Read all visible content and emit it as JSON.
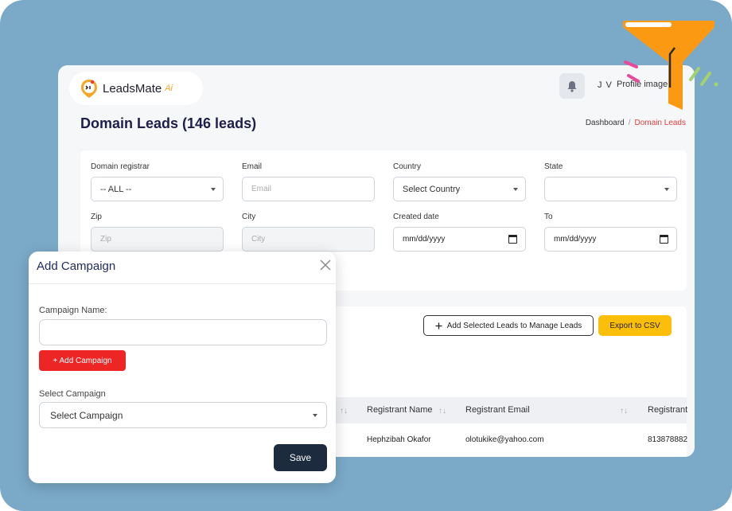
{
  "app": {
    "logo_name": "LeadsMate",
    "logo_suffix": "Ai",
    "user_initials": "J V",
    "profile_alt": "Profile image"
  },
  "header": {
    "title": "Domain Leads (146 leads)",
    "breadcrumb": {
      "home": "Dashboard",
      "separator": "/",
      "current": "Domain Leads"
    }
  },
  "filters": {
    "domain_registrar": {
      "label": "Domain registrar",
      "value": "-- ALL --"
    },
    "email": {
      "label": "Email",
      "placeholder": "Email"
    },
    "country": {
      "label": "Country",
      "value": "Select Country"
    },
    "state": {
      "label": "State",
      "value": ""
    },
    "zip": {
      "label": "Zip",
      "placeholder": "Zip"
    },
    "city": {
      "label": "City",
      "placeholder": "City"
    },
    "created_date": {
      "label": "Created date",
      "value": "mm/dd/yyyy"
    },
    "to": {
      "label": "To",
      "value": "mm/dd/yyyy"
    }
  },
  "actions": {
    "add_selected_leads": "Add Selected Leads to Manage Leads",
    "export_csv": "Export to CSV"
  },
  "table": {
    "columns": [
      "Registrant Name",
      "Registrant Email",
      "Registrant"
    ],
    "sort_glyph": "↑↓",
    "rows": [
      {
        "name": "Hephzibah Okafor",
        "email": "olotukike@yahoo.com",
        "phone": "813878882"
      }
    ]
  },
  "modal": {
    "title": "Add Campaign",
    "campaign_name_label": "Campaign Name:",
    "campaign_name_value": "",
    "add_campaign_button": "+ Add Campaign",
    "select_campaign_label": "Select Campaign",
    "select_campaign_value": "Select Campaign",
    "save_button": "Save"
  },
  "colors": {
    "background": "#7aaac8",
    "title": "#1e1e4a",
    "breadcrumb_active": "#e53e3e",
    "export_button": "#fbbf0a",
    "add_campaign_button": "#ee2525",
    "save_button": "#1d2b3f",
    "funnel": "#fb9a12"
  },
  "icons": [
    "leadsmate-logo-icon",
    "bell-icon",
    "chevron-down-icon",
    "calendar-icon",
    "plus-icon",
    "sort-icon",
    "close-icon",
    "funnel-icon"
  ]
}
